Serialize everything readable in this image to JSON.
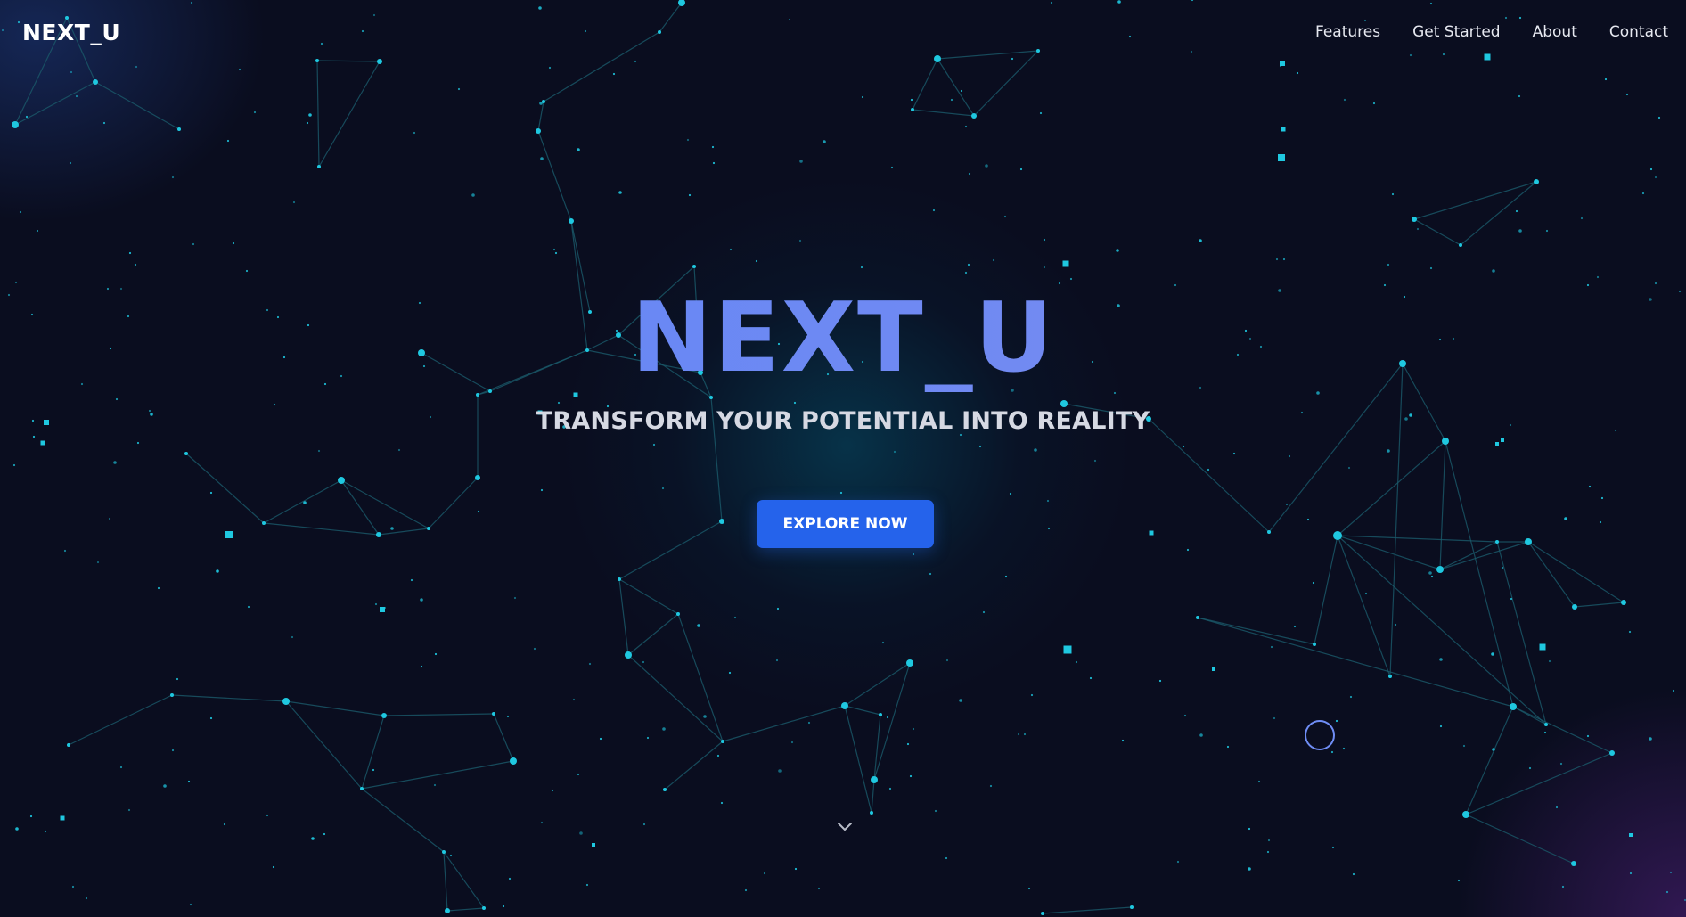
{
  "brand": {
    "logo_text": "NEXT_U"
  },
  "nav": {
    "items": [
      {
        "label": "Features"
      },
      {
        "label": "Get Started"
      },
      {
        "label": "About"
      },
      {
        "label": "Contact"
      }
    ]
  },
  "hero": {
    "title": "NEXT_U",
    "subtitle": "TRANSFORM YOUR POTENTIAL INTO REALITY",
    "cta_label": "EXPLORE NOW"
  },
  "icons": {
    "scroll": "chevron-down-icon",
    "cursor": "cursor-ring-icon"
  },
  "colors": {
    "background": "#0a0d1f",
    "accent": "#2563eb",
    "title_gradient_start": "#5c86f6",
    "title_gradient_end": "#7f8cf0",
    "particle": "#1fc8e0",
    "line": "#1a5a6a"
  }
}
